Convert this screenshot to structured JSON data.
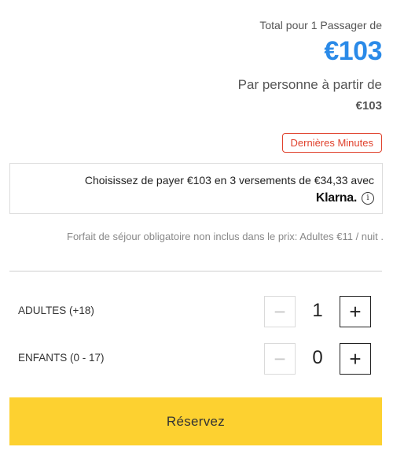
{
  "pricing": {
    "total_label": "Total pour 1 Passager de",
    "total_price": "€103",
    "per_person_label": "Par personne à partir de",
    "per_person_price": "€103",
    "badge": "Dernières Minutes"
  },
  "klarna": {
    "text": "Choisissez de payer €103 en 3 versements de €34,33 avec",
    "logo": "Klarna.",
    "info_icon": "i"
  },
  "fee_note": "Forfait de séjour obligatoire non inclus dans le prix: Adultes €11 / nuit .",
  "passengers": {
    "adults": {
      "label": "ADULTES (+18)",
      "count": "1"
    },
    "children": {
      "label": "ENFANTS (0 - 17)",
      "count": "0"
    },
    "minus_symbol": "−",
    "plus_symbol": "+"
  },
  "book_button": "Réservez",
  "colors": {
    "price_blue": "#2a8ae8",
    "badge_red": "#e0412c",
    "cta_yellow": "#fdd130"
  }
}
